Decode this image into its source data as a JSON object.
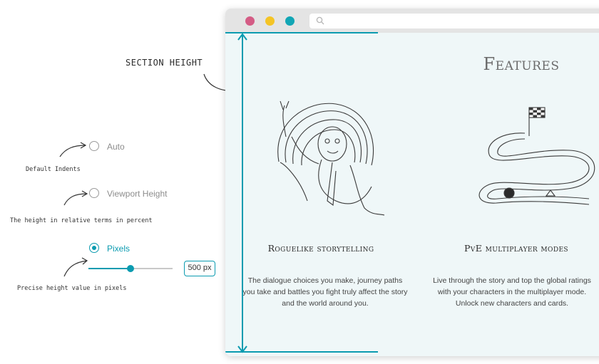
{
  "annotations": {
    "section_height": "SECTION HEIGHT",
    "default_indents": "Default Indents",
    "relative_terms": "The height in relative terms in percent",
    "precise_height": "Precise height value in pixels"
  },
  "height_options": [
    {
      "label": "Auto",
      "selected": false
    },
    {
      "label": "Viewport Height",
      "selected": false
    },
    {
      "label": "Pixels",
      "selected": true
    }
  ],
  "pixels_slider": {
    "value_fraction": 0.5
  },
  "pixels_field": {
    "value": "500 px"
  },
  "browser": {
    "dots": {
      "red": "#d45c85",
      "yellow": "#f4c425",
      "teal": "#12a6b5"
    },
    "accent": "#0b9bb0",
    "page": {
      "heading": "Features",
      "features": [
        {
          "title": "Roguelike storytelling",
          "lines": [
            "The dialogue choices you make, journey paths",
            "you take and battles you fight truly affect the story",
            "and the world around you."
          ]
        },
        {
          "title": "PvE multiplayer modes",
          "lines": [
            "Live through the story and top the global ratings",
            "with your characters in the multiplayer mode.",
            "Unlock new characters and cards."
          ]
        }
      ]
    }
  }
}
